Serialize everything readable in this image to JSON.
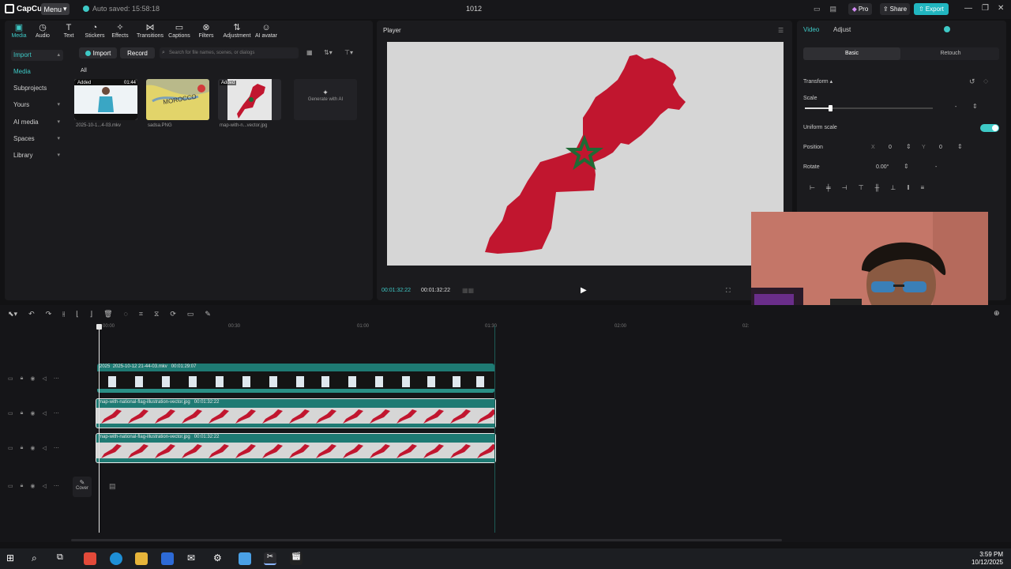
{
  "titlebar": {
    "app_name": "CapCut",
    "menu_label": "Menu",
    "autosave": "Auto saved: 15:58:18",
    "project_name": "1012",
    "pro_label": "Pro",
    "share_label": "Share",
    "export_label": "Export"
  },
  "toolbar": {
    "items": [
      {
        "label": "Media",
        "icon": "media-icon"
      },
      {
        "label": "Audio",
        "icon": "audio-icon"
      },
      {
        "label": "Text",
        "icon": "text-icon"
      },
      {
        "label": "Stickers",
        "icon": "stickers-icon"
      },
      {
        "label": "Effects",
        "icon": "effects-icon"
      },
      {
        "label": "Transitions",
        "icon": "transitions-icon"
      },
      {
        "label": "Captions",
        "icon": "captions-icon"
      },
      {
        "label": "Filters",
        "icon": "filters-icon"
      },
      {
        "label": "Adjustment",
        "icon": "adjustment-icon"
      },
      {
        "label": "AI avatar",
        "icon": "ai-avatar-icon"
      }
    ]
  },
  "sidebar": {
    "items": [
      {
        "label": "Import"
      },
      {
        "label": "Media"
      },
      {
        "label": "Subprojects"
      },
      {
        "label": "Yours"
      },
      {
        "label": "AI media"
      },
      {
        "label": "Spaces"
      },
      {
        "label": "Library"
      }
    ]
  },
  "media": {
    "import_label": "Import",
    "record_label": "Record",
    "search_placeholder": "Search for file names, scenes, or dialogs",
    "all_tab": "All",
    "generate_label": "Generate with AI",
    "items": [
      {
        "name": "2025-10-1...4-03.mkv",
        "tag": "Added",
        "duration": "01:44"
      },
      {
        "name": "sadsa.PNG",
        "tag": "",
        "duration": ""
      },
      {
        "name": "map-with-n...vector.jpg",
        "tag": "Added",
        "duration": ""
      }
    ]
  },
  "player": {
    "title": "Player",
    "current_time": "00:01:32:22",
    "total_time": "00:01:32:22"
  },
  "inspector": {
    "tabs": [
      "Video",
      "Adjust"
    ],
    "subtabs": [
      "Basic",
      "Retouch"
    ],
    "transform_label": "Transform",
    "scale_label": "Scale",
    "scale_value": "-",
    "scale_slider_fraction": 0.2,
    "uniform_scale_label": "Uniform scale",
    "uniform_scale_on": true,
    "position_label": "Position",
    "pos_x_label": "X",
    "pos_x": "0",
    "pos_y_label": "Y",
    "pos_y": "0",
    "rotate_label": "Rotate",
    "rotate_value": "0.00°",
    "rotate_extra": "-"
  },
  "timeline": {
    "ruler": [
      "00:00",
      "00:30",
      "01:00",
      "01:30",
      "02:00",
      "02:"
    ],
    "tracks": [
      {
        "label": "2025-10-12 21-44-03.mkv",
        "duration": "00:01:29:07",
        "prefix": "2025"
      },
      {
        "label": "map-with-national-flag-illustration-vector.jpg",
        "duration": "00:01:32:22"
      },
      {
        "label": "map-with-national-flag-illustration-vector.jpg",
        "duration": "00:01:32:22"
      }
    ],
    "cover_label": "Cover"
  },
  "taskbar": {
    "time": "3:59 PM",
    "date": "10/12/2025"
  },
  "colors": {
    "accent": "#3ec9c6",
    "clip_teal": "#1e7a73",
    "flag_red": "#c1162f",
    "flag_green": "#1f6a35"
  }
}
